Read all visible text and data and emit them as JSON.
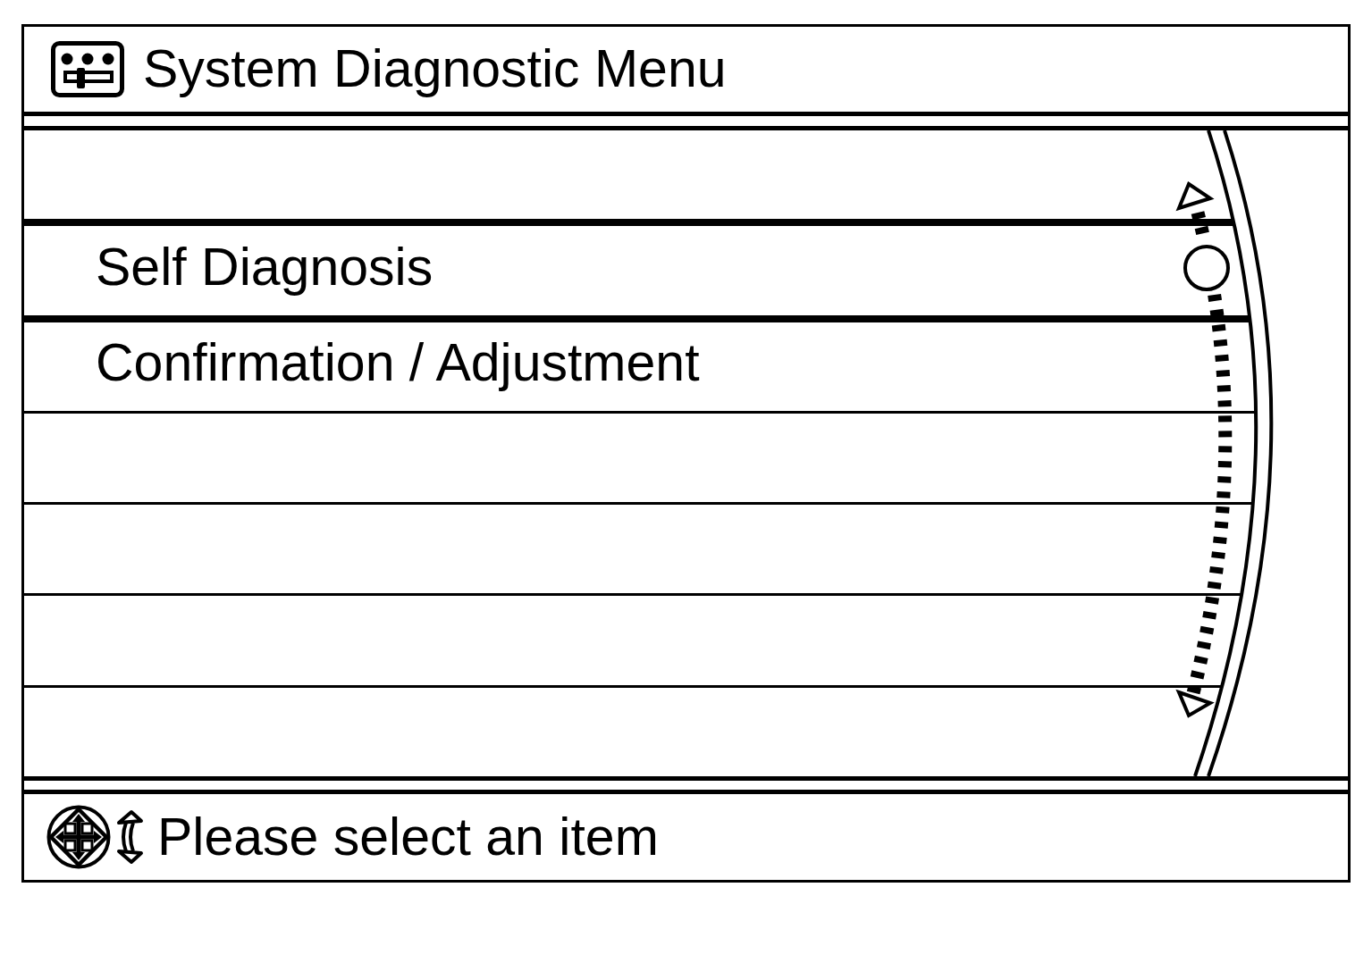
{
  "header": {
    "title": "System Diagnostic Menu"
  },
  "menu": {
    "items": [
      {
        "label": "Self Diagnosis",
        "selected": true
      },
      {
        "label": "Confirmation / Adjustment",
        "selected": false
      }
    ]
  },
  "status_bar": {
    "message": "Please select an item"
  }
}
